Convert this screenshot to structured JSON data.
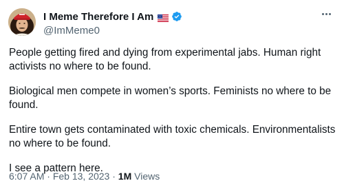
{
  "author": {
    "display_name": "I Meme Therefore I Am",
    "handle": "@ImMeme0",
    "flag_icon": "us-flag-icon",
    "verified_icon": "verified-badge-icon",
    "verified_color": "#1d9bf0"
  },
  "tweet": {
    "paragraphs": [
      "People getting fired and dying from experimental jabs. Human right activists no where to be found.",
      "Biological men compete in women’s sports. Feminists no where to be found.",
      "Entire town gets contaminated with toxic chemicals. Environmentalists no where to be found.",
      "I see a pattern here."
    ]
  },
  "meta": {
    "time": "6:07 AM",
    "separator": " · ",
    "date": "Feb 13, 2023",
    "views_count": "1M",
    "views_label": " Views"
  },
  "colors": {
    "text_primary": "#0f1419",
    "text_secondary": "#536471",
    "accent": "#1d9bf0"
  }
}
